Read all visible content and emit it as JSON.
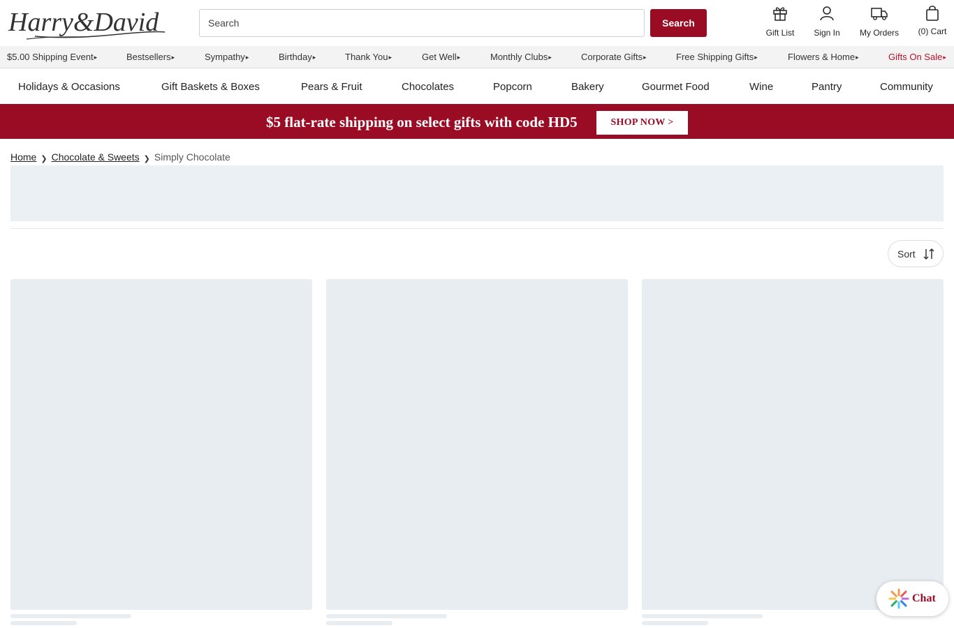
{
  "header": {
    "logo_text": "Harry&David",
    "search_placeholder": "Search",
    "search_button": "Search",
    "utilities": {
      "gift_list": "Gift List",
      "sign_in": "Sign In",
      "my_orders": "My Orders",
      "cart": "(0) Cart"
    }
  },
  "promo_nav": {
    "items": [
      "$5.00 Shipping Event",
      "Bestsellers",
      "Sympathy",
      "Birthday",
      "Thank You",
      "Get Well",
      "Monthly Clubs",
      "Corporate Gifts",
      "Free Shipping Gifts",
      "Flowers & Home",
      "Gifts On Sale"
    ],
    "arrow": "▸",
    "sale_color": "#b5122b"
  },
  "category_nav": {
    "items": [
      "Holidays & Occasions",
      "Gift Baskets & Boxes",
      "Pears & Fruit",
      "Chocolates",
      "Popcorn",
      "Bakery",
      "Gourmet Food",
      "Wine",
      "Pantry",
      "Community"
    ]
  },
  "banner": {
    "text": "$5 flat-rate shipping on select gifts with code HD5",
    "button": "SHOP NOW >",
    "color": "#9a0b24"
  },
  "breadcrumb": {
    "home": "Home",
    "parent": "Chocolate & Sweets",
    "current": "Simply Chocolate",
    "separator": "❯"
  },
  "sort": {
    "label": "Sort"
  },
  "chat": {
    "label": "Chat"
  },
  "colors": {
    "brand": "#9a0b24",
    "skeleton": "#e8edf2"
  }
}
